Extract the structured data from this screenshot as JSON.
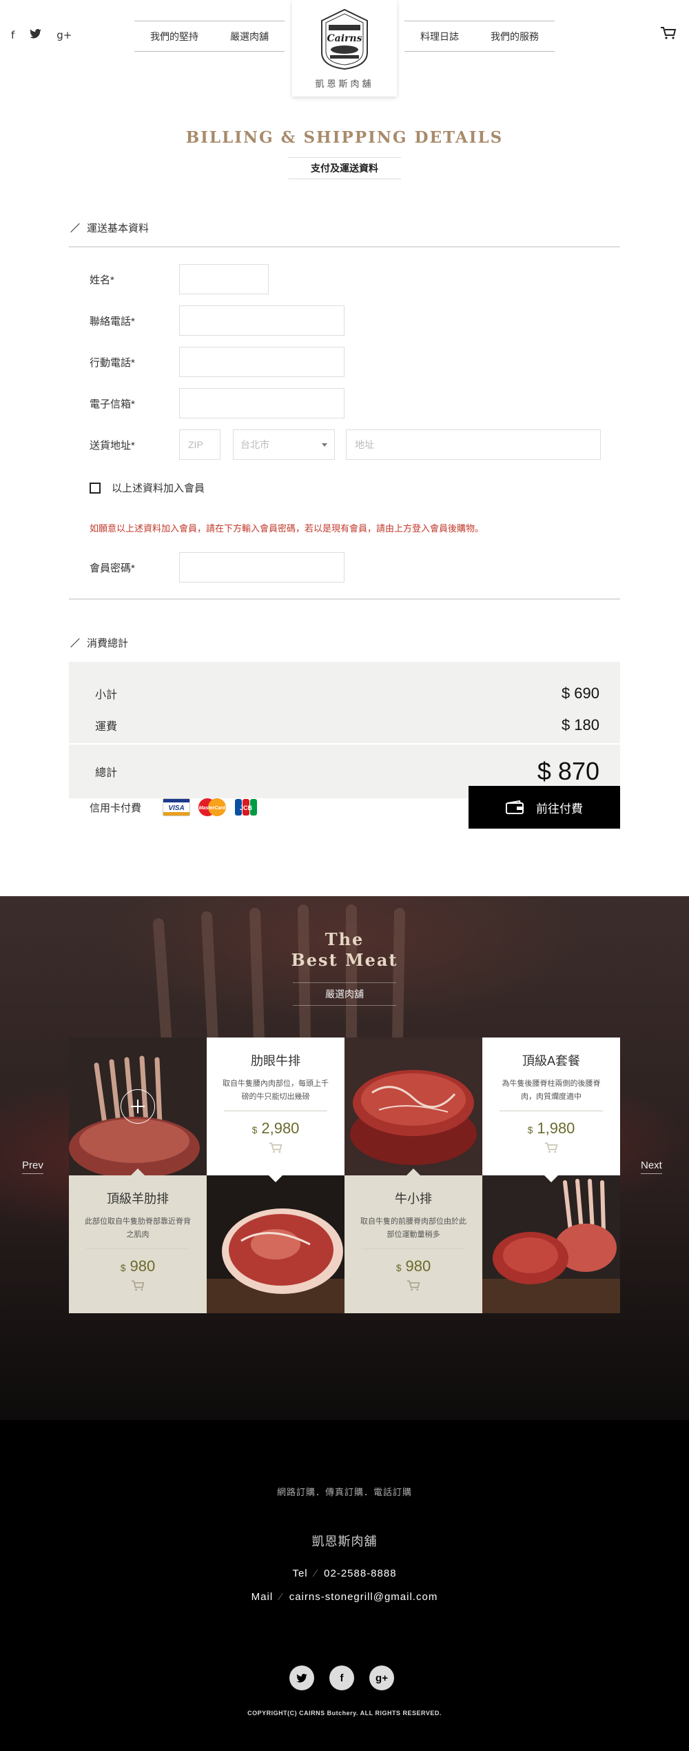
{
  "header": {
    "social": [
      "f",
      "t",
      "g+"
    ],
    "nav_left": [
      "我們的堅持",
      "嚴選肉舖"
    ],
    "nav_right": [
      "料理日誌",
      "我們的服務"
    ],
    "logo_text": "Cairns",
    "logo_caption": "凱恩斯肉舖"
  },
  "page": {
    "title": "BILLING & SHIPPING DETAILS",
    "subtitle": "支付及運送資料"
  },
  "shipping": {
    "heading": "運送基本資料",
    "name_label": "姓名*",
    "phone_label": "聯絡電話*",
    "mobile_label": "行動電話*",
    "email_label": "電子信箱*",
    "address_label": "送貨地址*",
    "zip_placeholder": "ZIP",
    "city_value": "台北市",
    "address_placeholder": "地址",
    "join_label": "以上述資料加入會員",
    "notice": "如願意以上述資料加入會員，請在下方輸入會員密碼，若以是現有會員，請由上方登入會員後購物。",
    "password_label": "會員密碼*"
  },
  "summary": {
    "heading": "消費總計",
    "subtotal_label": "小計",
    "subtotal_value": "$ 690",
    "shipping_label": "運費",
    "shipping_value": "$ 180",
    "total_label": "總計",
    "total_value": "$ 870",
    "card_label": "信用卡付費",
    "cards": [
      "VISA",
      "MasterCard",
      "JCB"
    ],
    "pay_button": "前往付費"
  },
  "best_meat": {
    "title_line1": "The",
    "title_line2": "Best Meat",
    "subtitle": "嚴選肉舖",
    "prev": "Prev",
    "next": "Next",
    "products": [
      {
        "name": "肋眼牛排",
        "desc": "取自牛隻腰內肉部位，每頭上千磅的牛只能切出幾磅",
        "currency": "$",
        "price": "2,980"
      },
      {
        "name": "頂級A套餐",
        "desc": "為牛隻後腰脊柱兩側的後腰脊肉，肉質爛度適中",
        "currency": "$",
        "price": "1,980"
      },
      {
        "name": "頂級羊肋排",
        "desc": "此部位取自牛隻肋脊部靠近脊背之肌肉",
        "currency": "$",
        "price": "980"
      },
      {
        "name": "牛小排",
        "desc": "取自牛隻的前腰脊肉部位由於此部位運動量稍多",
        "currency": "$",
        "price": "980"
      }
    ]
  },
  "footer": {
    "order_methods": "網路訂購．傳真訂購．電話訂購",
    "store_name": "凱恩斯肉舖",
    "tel_label": "Tel",
    "tel": "02-2588-8888",
    "mail_label": "Mail",
    "mail": "cairns-stonegrill@gmail.com",
    "social": [
      "t",
      "f",
      "g+"
    ],
    "copyright": "COPYRIGHT(C) CAIRNS Butchery. ALL RIGHTS RESERVED."
  },
  "colors": {
    "accent_brown": "#a88b6c",
    "notice_red": "#c0392b",
    "price_olive": "#6b6a2c",
    "beige": "#e0dccf"
  }
}
